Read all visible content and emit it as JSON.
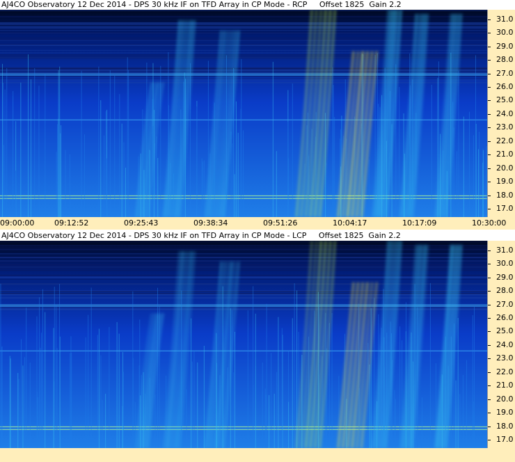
{
  "chart_data": [
    {
      "type": "heatmap",
      "title": "AJ4CO Observatory 12 Dec 2014 - DPS 30 kHz IF on TFD Array in CP Mode - RCP     Offset 1825  Gain 2.2",
      "x_tick_labels": [
        "09:00:00",
        "09:12:52",
        "09:25:43",
        "09:38:34",
        "09:51:26",
        "10:04:17",
        "10:17:09",
        "10:30:00"
      ],
      "y_tick_labels": [
        "31.0",
        "30.0",
        "29.0",
        "28.0",
        "27.0",
        "26.0",
        "25.0",
        "24.0",
        "23.0",
        "22.0",
        "21.0",
        "20.0",
        "19.0",
        "18.0",
        "17.0"
      ],
      "ylim": [
        16.4,
        31.7
      ],
      "colormap": [
        "#000820",
        "#001a70",
        "#0a3cc8",
        "#1f7ee8",
        "#36c0f0",
        "#b8f060",
        "#fff040"
      ]
    },
    {
      "type": "heatmap",
      "title": "AJ4CO Observatory 12 Dec 2014 - DPS 30 kHz IF on TFD Array in CP Mode - LCP     Offset 1825  Gain 2.2",
      "x_tick_labels": [],
      "y_tick_labels": [
        "31.0",
        "30.0",
        "29.0",
        "28.0",
        "27.0",
        "26.0",
        "25.0",
        "24.0",
        "23.0",
        "22.0",
        "21.0",
        "20.0",
        "19.0",
        "18.0",
        "17.0"
      ],
      "ylim": [
        16.4,
        31.7
      ],
      "colormap": [
        "#000820",
        "#001a70",
        "#0a3cc8",
        "#1f7ee8",
        "#36c0f0",
        "#b8f060",
        "#fff040"
      ]
    }
  ],
  "colors": {
    "axis_background": "#ffeebb",
    "title_background": "#ffffff",
    "text": "#000000"
  }
}
